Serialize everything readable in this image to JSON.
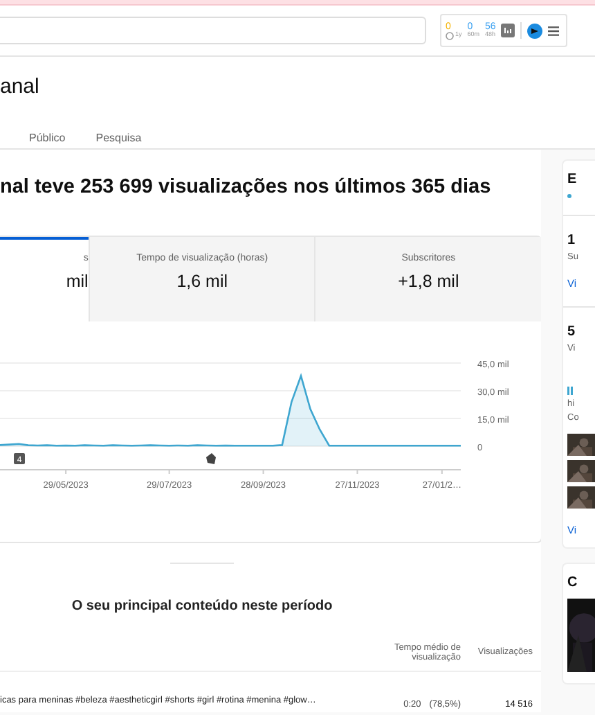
{
  "header": {
    "extension": {
      "counters": [
        {
          "kind": "time",
          "value": "0",
          "label": "1y"
        },
        {
          "kind": "plain",
          "value": "0",
          "label": "60m"
        },
        {
          "kind": "plain",
          "value": "56",
          "label": "48h"
        }
      ]
    }
  },
  "page_title": "anal",
  "tabs": [
    {
      "label": "Público",
      "selected": false
    },
    {
      "label": "Pesquisa",
      "selected": false
    }
  ],
  "headline": "nal teve 253 699 visualizações nos últimos 365 dias",
  "metrics": [
    {
      "label": "s",
      "value": "mil",
      "selected": true
    },
    {
      "label": "Tempo de visualização (horas)",
      "value": "1,6 mil",
      "selected": false
    },
    {
      "label": "Subscritores",
      "value": "+1,8 mil",
      "selected": false
    }
  ],
  "chart": {
    "chart_data": {
      "type": "area",
      "ylim": [
        0,
        45
      ],
      "yticks": [
        {
          "value": 0,
          "label": "0"
        },
        {
          "value": 15,
          "label": "15,0 mil"
        },
        {
          "value": 30,
          "label": "30,0 mil"
        },
        {
          "value": 45,
          "label": "45,0 mil"
        }
      ],
      "categories": [
        null,
        null,
        null,
        null,
        null,
        null,
        null,
        "29/05/2023",
        null,
        null,
        null,
        null,
        null,
        null,
        null,
        null,
        null,
        null,
        "29/07/2023",
        null,
        null,
        null,
        null,
        null,
        null,
        null,
        null,
        null,
        "28/09/2023",
        null,
        null,
        null,
        null,
        null,
        null,
        null,
        null,
        null,
        "27/11/2023",
        null,
        null,
        null,
        null,
        null,
        null,
        null,
        null,
        "27/01/2…",
        null,
        null
      ],
      "series": [
        {
          "color": "#3ea6d0",
          "values": [
            0.6,
            0.9,
            1.2,
            0.5,
            0.4,
            0.5,
            0.3,
            0.4,
            0.3,
            0.5,
            0.4,
            0.3,
            0.5,
            0.4,
            0.3,
            0.4,
            0.5,
            0.4,
            0.3,
            0.4,
            0.3,
            0.5,
            0.4,
            0.3,
            0.4,
            0.3,
            0.3,
            0.3,
            0.3,
            0.3,
            0.6,
            24,
            38,
            20,
            9,
            0.3,
            0.3,
            0.3,
            0.3,
            0.3,
            0.3,
            0.3,
            0.3,
            0.3,
            0.3,
            0.3,
            0.3,
            0.3,
            0.3,
            0.3
          ]
        }
      ]
    },
    "markers": [
      {
        "kind": "number",
        "text": "4"
      },
      {
        "kind": "icon"
      }
    ]
  },
  "top_content": {
    "title": "O seu principal conteúdo neste período",
    "columns": [
      "Tempo médio de visualização",
      "Visualizações"
    ],
    "rows": [
      {
        "title": "icas para meninas #beleza #aestheticgirl #shorts #girl #rotina #menina #glow…",
        "avg_time": "0:20",
        "avg_pct": "(78,5%)",
        "views": "14 516"
      }
    ]
  },
  "side": {
    "cards": [
      {
        "items": [
          {
            "kind": "heading",
            "text": "E"
          },
          {
            "kind": "dot"
          },
          {
            "kind": "rule"
          },
          {
            "kind": "big",
            "text": "1"
          },
          {
            "kind": "small",
            "text": "Su"
          },
          {
            "kind": "link",
            "text": "Vi"
          },
          {
            "kind": "rule"
          },
          {
            "kind": "big",
            "text": "5"
          },
          {
            "kind": "small",
            "text": "Vi"
          },
          {
            "kind": "bars"
          },
          {
            "kind": "small",
            "text": "hi"
          },
          {
            "kind": "small",
            "text": "Co"
          },
          {
            "kind": "thumb"
          },
          {
            "kind": "thumb"
          },
          {
            "kind": "thumb"
          },
          {
            "kind": "link",
            "text": "Vi"
          }
        ]
      },
      {
        "items": [
          {
            "kind": "heading",
            "text": "C"
          },
          {
            "kind": "video"
          }
        ]
      }
    ]
  }
}
